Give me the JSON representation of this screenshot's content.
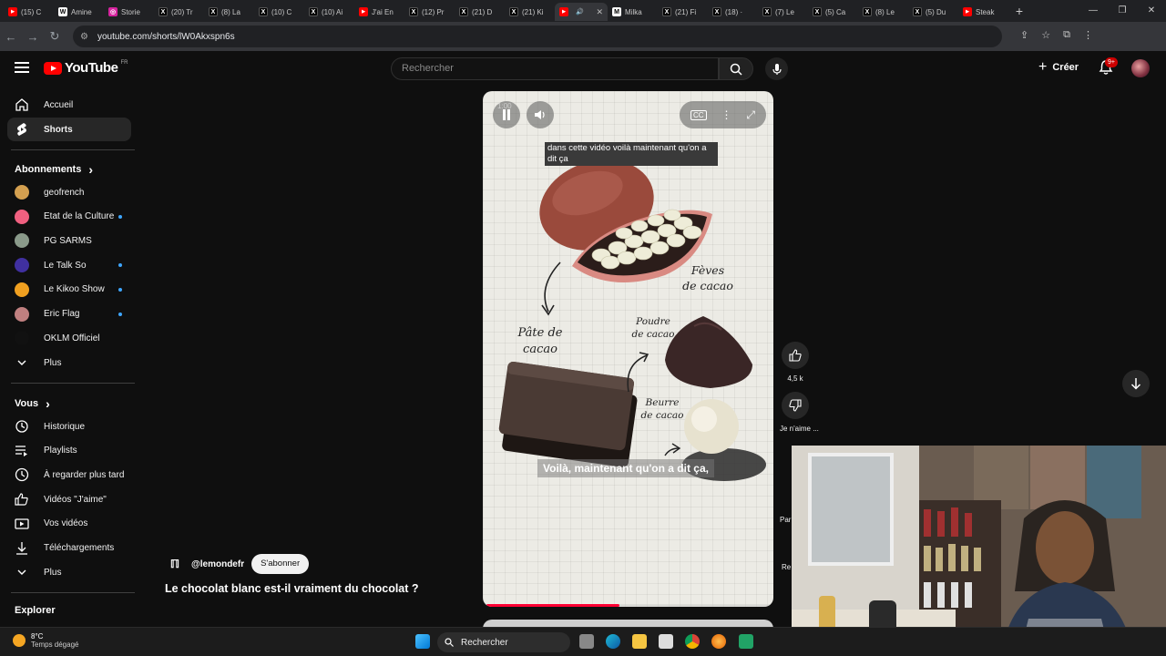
{
  "browser": {
    "tabs": [
      {
        "title": "(15) C",
        "fav": "yt",
        "color": "#ff0000"
      },
      {
        "title": "Amine",
        "fav": "W",
        "color": "#ffffff"
      },
      {
        "title": "Storie",
        "fav": "ig",
        "color": "#d6249f"
      },
      {
        "title": "(20) Tr",
        "fav": "X",
        "color": "#000000"
      },
      {
        "title": "(8) La",
        "fav": "X",
        "color": "#000000"
      },
      {
        "title": "(10) C",
        "fav": "X",
        "color": "#000000"
      },
      {
        "title": "(10) Ai",
        "fav": "X",
        "color": "#000000"
      },
      {
        "title": "J'ai En",
        "fav": "yt",
        "color": "#ff0000"
      },
      {
        "title": "(12) Pr",
        "fav": "X",
        "color": "#000000"
      },
      {
        "title": "(21) D",
        "fav": "X",
        "color": "#000000"
      },
      {
        "title": "(21) Ki",
        "fav": "X",
        "color": "#000000"
      },
      {
        "title": "",
        "fav": "yt",
        "color": "#ff0000",
        "active": true
      },
      {
        "title": "Milka",
        "fav": "Ⓜ",
        "color": "#ffffff"
      },
      {
        "title": "(21) Fi",
        "fav": "X",
        "color": "#000000"
      },
      {
        "title": "(18) ·",
        "fav": "X",
        "color": "#000000"
      },
      {
        "title": "(7) Le",
        "fav": "X",
        "color": "#000000"
      },
      {
        "title": "(5) Ca",
        "fav": "X",
        "color": "#000000"
      },
      {
        "title": "(8) Le",
        "fav": "X",
        "color": "#000000"
      },
      {
        "title": "(5) Du",
        "fav": "X",
        "color": "#000000"
      },
      {
        "title": "Steak",
        "fav": "yt",
        "color": "#ff0000"
      }
    ],
    "url": "youtube.com/shorts/lW0Akxspn6s"
  },
  "header": {
    "logo_text": "YouTube",
    "logo_region": "FR",
    "search_placeholder": "Rechercher",
    "create_label": "Créer",
    "notif_count": "9+"
  },
  "sidebar": {
    "main": [
      {
        "label": "Accueil",
        "icon": "home-icon"
      },
      {
        "label": "Shorts",
        "icon": "shorts-icon",
        "active": true
      }
    ],
    "subs_title": "Abonnements",
    "subscriptions": [
      {
        "label": "geofrench",
        "color": "#d4a050",
        "dot": false
      },
      {
        "label": "Etat de la Culture",
        "color": "#f06080",
        "dot": true
      },
      {
        "label": "PG SARMS",
        "color": "#8a9a8a",
        "dot": false
      },
      {
        "label": "Le Talk So",
        "color": "#4030a0",
        "dot": true
      },
      {
        "label": "Le Kikoo Show",
        "color": "#f0a020",
        "dot": true
      },
      {
        "label": "Eric Flag",
        "color": "#c08080",
        "dot": true
      },
      {
        "label": "OKLM Officiel",
        "color": "#111111",
        "dot": false
      }
    ],
    "subs_more": "Plus",
    "you_title": "Vous",
    "you_items": [
      {
        "label": "Historique",
        "icon": "history-icon"
      },
      {
        "label": "Playlists",
        "icon": "playlists-icon"
      },
      {
        "label": "À regarder plus tard",
        "icon": "watch-later-icon"
      },
      {
        "label": "Vidéos \"J'aime\"",
        "icon": "liked-icon"
      },
      {
        "label": "Vos vidéos",
        "icon": "your-videos-icon"
      },
      {
        "label": "Téléchargements",
        "icon": "downloads-icon"
      }
    ],
    "you_more": "Plus",
    "explore_title": "Explorer"
  },
  "player": {
    "time": "1:00",
    "subtitle_top": "dans cette vidéo voilà maintenant qu'on a dit ça",
    "subtitle_bottom": "Voilà, maintenant qu'on a dit ça,",
    "labels": {
      "feves": "Fèves\nde cacao",
      "pate": "Pâte de\ncacao",
      "poudre": "Poudre\nde cacao",
      "beurre": "Beurre\nde cacao"
    },
    "progress": 0.47
  },
  "actions": {
    "likes": "4,5 k",
    "dislike_label": "Je n'aime ...",
    "partial1": "Par",
    "partial2": "Re"
  },
  "video": {
    "channel": "@lemondefr",
    "subscribe": "S'abonner",
    "title": "Le chocolat blanc est-il vraiment du chocolat ?"
  },
  "taskbar": {
    "temp": "8°C",
    "weather": "Temps dégagé",
    "search": "Rechercher"
  }
}
